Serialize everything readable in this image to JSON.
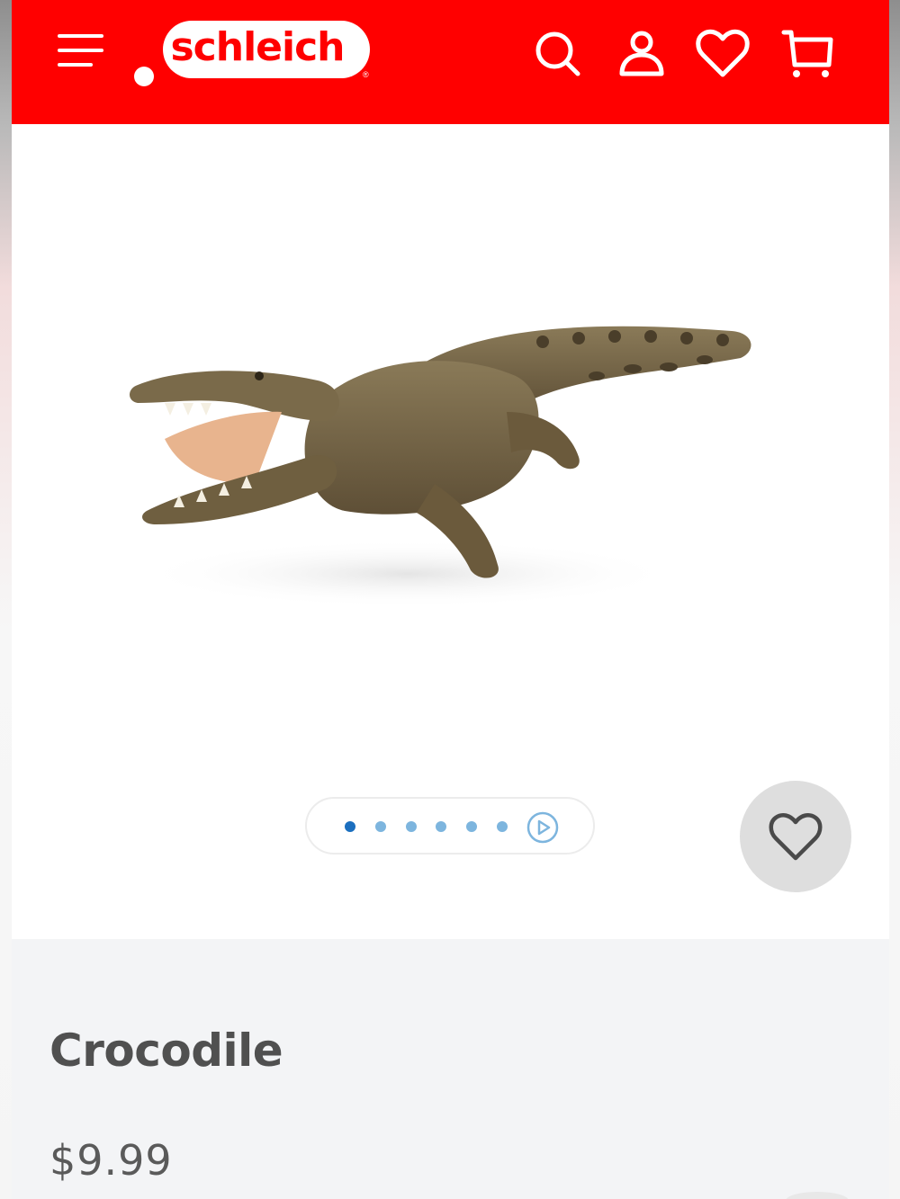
{
  "header": {
    "brand": "schleich",
    "brand_mark": "®",
    "icons": [
      "menu-icon",
      "search-icon",
      "account-icon",
      "heart-icon",
      "cart-icon"
    ],
    "background_color": "#ff0000"
  },
  "gallery": {
    "image": "crocodile-figurine",
    "slide_count": 6,
    "active_slide": 1,
    "video_icon": "play-icon",
    "dot_active_color": "#1b6fbf",
    "dot_color": "#7db5de"
  },
  "product": {
    "title": "Crocodile",
    "price": "$9.99"
  }
}
